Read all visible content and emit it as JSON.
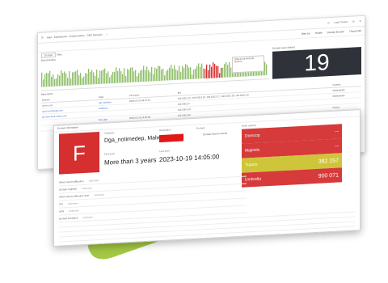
{
  "colors": {
    "blob": "#a3c843",
    "grade": "#d62f2f",
    "swatch": "#e01818",
    "counter_bg": "#2f3339",
    "link": "#3a6fbf"
  },
  "window": {
    "breadcrumb": "Haut · Dashboards · Dossier Adhoc · DNS Domains",
    "time_range": "Last 2 hours",
    "actions": [
      "Web Inc",
      "Health",
      "Domain Erosion",
      "Threat intel"
    ],
    "filter_text": "Domain",
    "search_label": "Filter",
    "timeline_label": "Event History",
    "tooltip_time": "2023-10-19 14:05:00",
    "tooltip_series": "Matches",
    "counter_label": "Domain seen distinct",
    "counter_value": "19",
    "table_title": "Main Items",
    "columns": [
      "Domain",
      "Tags",
      "First seen",
      "IPs",
      "Country"
    ],
    "rows": [
      {
        "domain": "domo.com",
        "tags": "cgf_malware",
        "first": "2023-10-12 03:37:41",
        "ips": "192.168.2.15, 192.168.2.16, 192.168.2.17, 192.168.2.18, 192.168.2.19",
        "country": "Netherlands"
      },
      {
        "domain": "ucd-x-exchange.com",
        "tags": "malicious",
        "first": "",
        "ips": "192.168.3.4",
        "country": "Netherlands"
      },
      {
        "domain": "joe-web-tarot-online.com",
        "tags": "",
        "first": "",
        "ips": "192.168.4.22",
        "country": ""
      },
      {
        "domain": "",
        "tags": "bad_dga",
        "first": "2023-10-19 14:05:00",
        "ips": "192.168.5.81",
        "country": "France"
      },
      {
        "domain": "",
        "tags": "",
        "first": "",
        "ips": "",
        "country": "Canada"
      }
    ]
  },
  "detail": {
    "header": "Domain information",
    "grade": "F",
    "category_label": "Category",
    "category_value": "Dga_notimedep, Malware",
    "reputation_label": "Reputation",
    "first_seen_label": "First seen",
    "first_seen_value": "More than 3 years",
    "last_seen_label": "Last seen",
    "last_seen_value": "2023-10-19 14:05:00",
    "domain_label": "Domain",
    "domain_note": "Domain found in feeds",
    "ranks_label": "Rank ranking",
    "ranks": [
      {
        "name": "Domcop",
        "value": "--",
        "color": "#d63a3a"
      },
      {
        "name": "Majestic",
        "value": "--",
        "color": "#d63a3a"
      },
      {
        "name": "Tranco",
        "value": "382 257",
        "color": "#cfc53a"
      },
      {
        "name": "Umbrella",
        "value": "900 071",
        "color": "#d63a3a"
      }
    ],
    "info_rows": [
      {
        "label": "Whois last modification",
        "value": "Unknown"
      },
      {
        "label": "Domain registrar",
        "value": "Unknown"
      },
      {
        "label": "Whois last modification date",
        "value": "Unknown"
      },
      {
        "label": "IPS",
        "value": "Unknown"
      },
      {
        "label": "ASN",
        "value": "Unknown"
      },
      {
        "label": "Domain feedback",
        "value": "Unknown"
      }
    ]
  }
}
